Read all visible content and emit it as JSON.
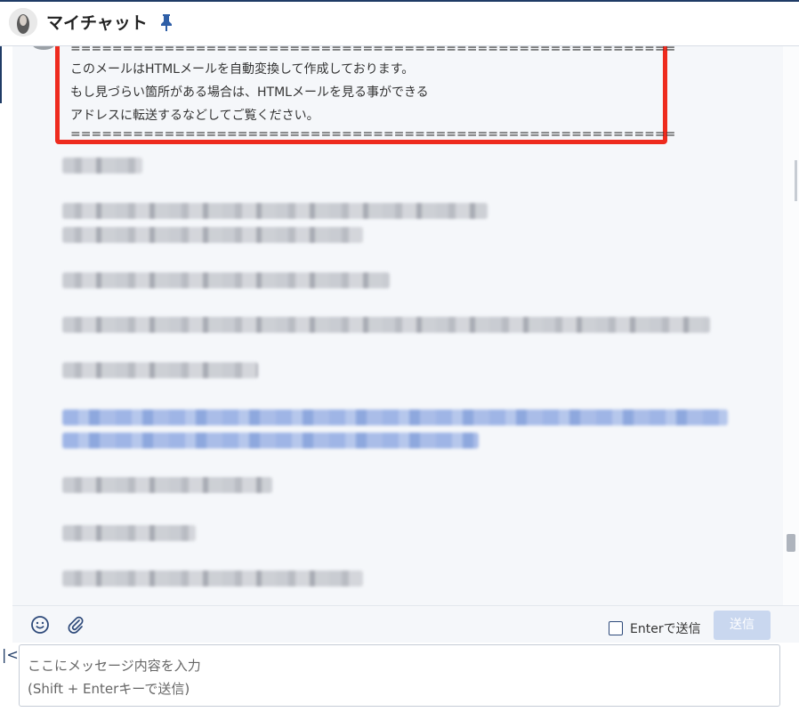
{
  "header": {
    "title": "マイチャット"
  },
  "message": {
    "separator_top": "==========================================================",
    "line1": "このメールはHTMLメールを自動変換して作成しております。",
    "line2": "もし見づらい箇所がある場合は、HTMLメールを見る事ができる",
    "line3": "アドレスに転送するなどしてご覧ください。",
    "separator_bottom": "=========================================================="
  },
  "compose": {
    "enter_send_label": "Enterで送信",
    "send_button": "送信",
    "placeholder_line1": "ここにメッセージ内容を入力",
    "placeholder_line2": "(Shift + Enterキーで送信)"
  },
  "icons": {
    "pin": "pin-icon",
    "emoji": "emoji-icon",
    "attach": "paperclip-icon",
    "collapse": "collapse-left-icon"
  },
  "colors": {
    "highlight_border": "#ee2b1e",
    "accent": "#1f3b66",
    "send_disabled": "#c9d7ef",
    "background": "#f5f7fa"
  }
}
